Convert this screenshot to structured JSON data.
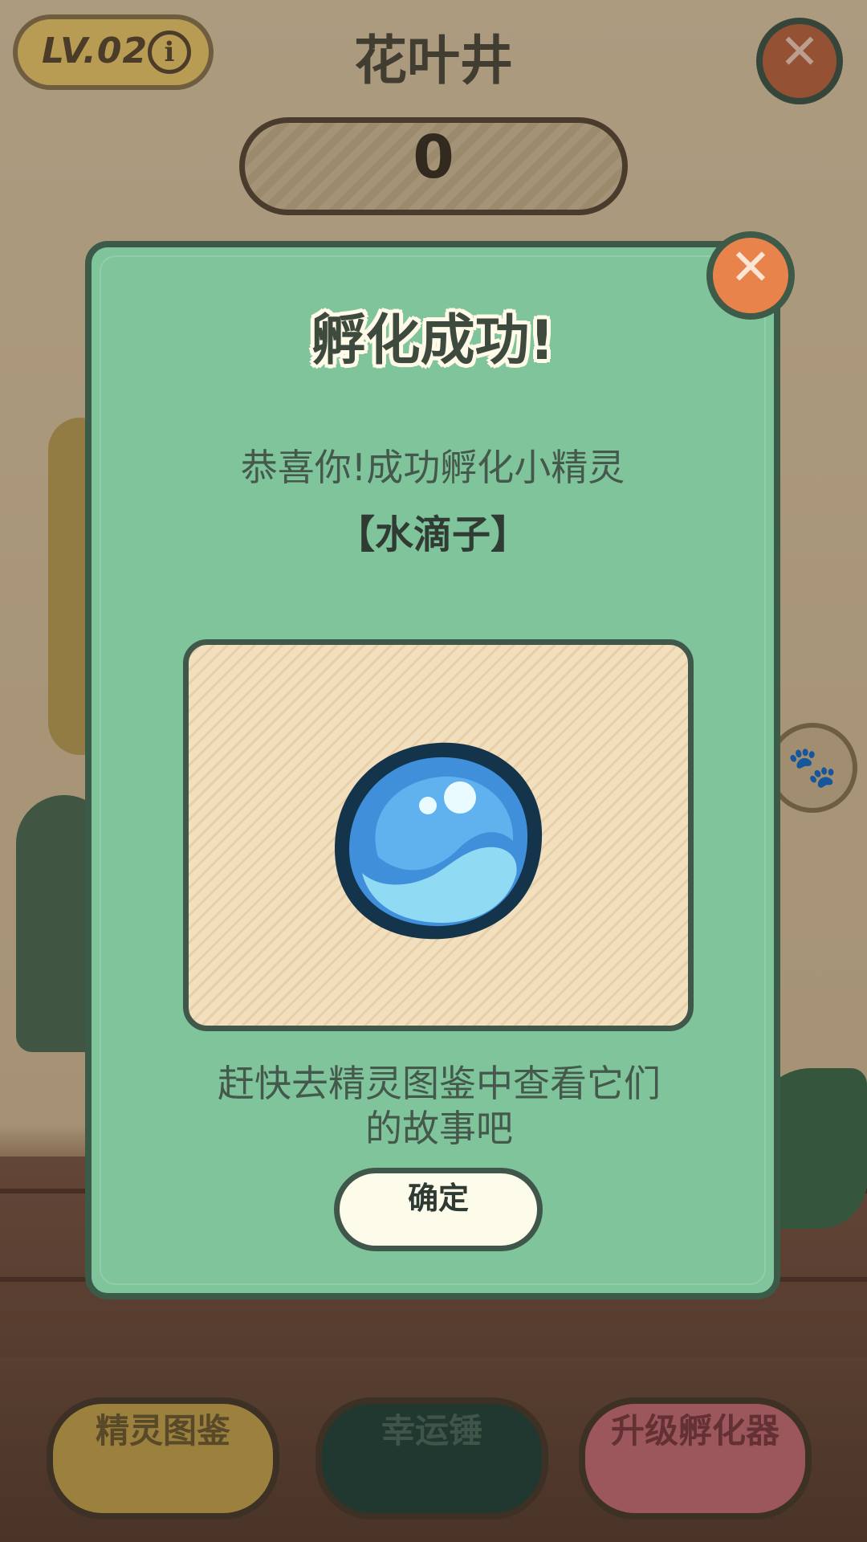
{
  "scene": {
    "level": "LV.02",
    "title": "花叶井",
    "score": "0",
    "buttons": {
      "codex": "精灵图鉴",
      "hammer": "幸运锤",
      "upgrade": "升级孵化器"
    }
  },
  "dialog": {
    "title": "孵化成功!",
    "message": "恭喜你!成功孵化小精灵",
    "creature_name": "【水滴子】",
    "hint_line1": "赶快去精灵图鉴中查看它们",
    "hint_line2": "的故事吧",
    "confirm": "确定"
  },
  "colors": {
    "dialog_bg": "#80c49c",
    "dialog_border": "#3b5a48",
    "close_button": "#e7834b",
    "creature_blue": "#4aa6e6"
  },
  "icons": {
    "info": "info-icon",
    "close": "close-icon",
    "paw": "paw-icon",
    "creature": "water-drop-sprite"
  }
}
